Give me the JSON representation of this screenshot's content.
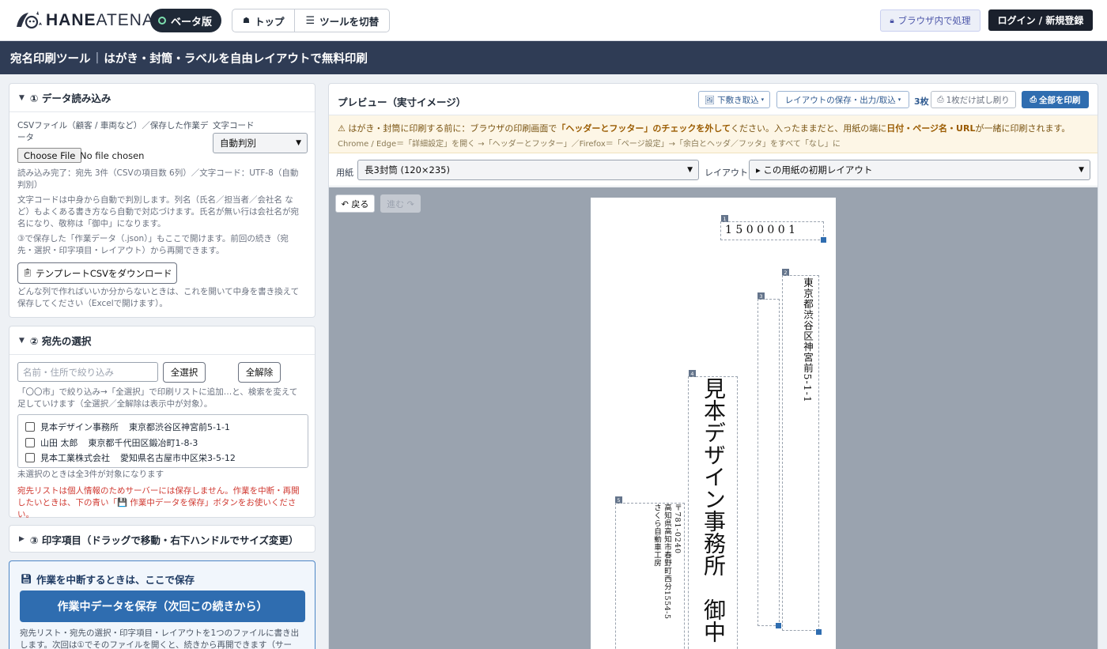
{
  "header": {
    "logo_text_bold": "HANE",
    "logo_text_light": "ATENA",
    "beta_label": "ベータ版",
    "nav_top": "トップ",
    "nav_switch": "ツールを切替",
    "browser_badge": "ブラウザ内で処理",
    "login": "ログイン / 新規登録"
  },
  "titlebar": {
    "title": "宛名印刷ツール",
    "separator": "|",
    "subtitle": "はがき・封筒・ラベルを自由レイアウトで無料印刷"
  },
  "section1": {
    "heading": "① データ読み込み",
    "csv_label": "CSVファイル（顧客 / 車両など）／保存した作業データ",
    "charset_label": "文字コード",
    "charset_value": "自動判別",
    "file_button": "Choose File",
    "file_status": "No file chosen",
    "load_status": "読み込み完了：宛先 3件（CSVの項目数 6列）／文字コード：UTF-8（自動判別）",
    "help1": "文字コードは中身から自動で判別します。列名（氏名／担当者／会社名 など）もよくある書き方なら自動で対応づけます。氏名が無い行は会社名が宛名になり、敬称は「御中」になります。",
    "help2": "③で保存した「作業データ（.json）」もここで開けます。前回の続き（宛先・選択・印字項目・レイアウト）から再開できます。",
    "template_button": "テンプレートCSVをダウンロード",
    "help3": "どんな列で作ればいいか分からないときは、これを開いて中身を書き換えて保存してください（Excelで開けます）。"
  },
  "section2": {
    "heading": "② 宛先の選択",
    "filter_placeholder": "名前・住所で絞り込み",
    "select_all": "全選択",
    "clear_all": "全解除",
    "help": "「〇〇市」で絞り込み→「全選択」で印刷リストに追加…と、検索を変えて足していけます（全選択／全解除は表示中が対象）。",
    "recipients": [
      {
        "name": "見本デザイン事務所",
        "address": "東京都渋谷区神宮前5-1-1"
      },
      {
        "name": "山田 太郎",
        "address": "東京都千代田区鍛冶町1-8-3"
      },
      {
        "name": "見本工業株式会社",
        "address": "愛知県名古屋市中区栄3-5-12"
      }
    ],
    "unselected_note": "未選択のときは全3件が対象になります",
    "privacy_warning": "宛先リストは個人情報のためサーバーには保存しません。作業を中断・再開したいときは、下の青い「💾 作業中データを保存」ボタンをお使いください。"
  },
  "section3": {
    "heading": "③ 印字項目（ドラッグで移動・右下ハンドルでサイズ変更）"
  },
  "save_section": {
    "heading": "作業を中断するときは、ここで保存",
    "button": "作業中データを保存（次回この続きから）",
    "help": "宛先リスト・宛先の選択・印字項目・レイアウトを1つのファイルに書き出します。次回は①でそのファイルを開くと、続きから再開できます（サー"
  },
  "preview": {
    "title": "プレビュー（実寸イメージ）",
    "import_bg": "下敷き取込",
    "layout_menu": "レイアウトの保存・出力/取込",
    "count": "3枚",
    "test_print": "1枚だけ試し刷り",
    "print_all": "全部を印刷",
    "notice_prefix": "はがき・封筒に印刷する前に：ブラウザの印刷画面で",
    "notice_bold": "「ヘッダーとフッター」のチェックを外して",
    "notice_mid": "ください。入ったままだと、用紙の端に",
    "notice_bold2": "日付・ページ名・URL",
    "notice_suffix": "が一緒に印刷されます。",
    "notice_line2": "Chrome / Edge＝「詳細設定」を開く →「ヘッダーとフッター」／Firefox＝「ページ設定」→「余白とヘッダ／フッタ」をすべて「なし」に",
    "paper_label": "用紙",
    "paper_value": "長3封筒 (120×235)",
    "layout_label": "レイアウト",
    "layout_value": "▸ この用紙の初期レイアウト",
    "back": "↶ 戻る",
    "forward": "進む ↷"
  },
  "envelope": {
    "postal": "1 5 0 0 0 0 1",
    "address": "東京都渋谷区神宮前5-1-1",
    "recipient": "見本デザイン事務所　御中",
    "sender_postal": "〒781-0240",
    "sender_address": "高知県高知市春野町西分1554-5",
    "sender_name": "さくら自動車工房",
    "tags": [
      "1",
      "2",
      "3",
      "4",
      "5"
    ]
  },
  "colors": {
    "titlebar": "#2f3c55",
    "primary": "#2f6db0",
    "stage": "#9aa3af",
    "warning": "#d03a32"
  }
}
